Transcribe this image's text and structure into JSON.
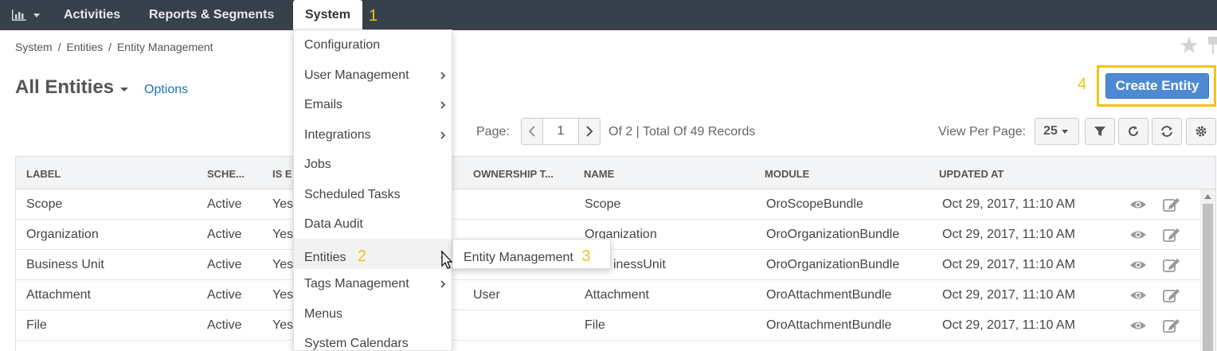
{
  "nav": {
    "items": [
      "Activities",
      "Reports & Segments",
      "System"
    ],
    "system_step": "1"
  },
  "breadcrumb": [
    "System",
    "/",
    "Entities",
    "/",
    "Entity Management"
  ],
  "heading": {
    "title": "All Entities",
    "options": "Options"
  },
  "create": {
    "label": "Create Entity",
    "step": "4"
  },
  "pager": {
    "label": "Page:",
    "page": "1",
    "info": "Of 2 | Total Of 49 Records",
    "view_per_page_label": "View Per Page:",
    "view_per_page": "25"
  },
  "table": {
    "headers": [
      "LABEL",
      "SCHE...",
      "IS E",
      "OWNERSHIP T...",
      "NAME",
      "MODULE",
      "UPDATED AT"
    ],
    "rows": [
      {
        "label": "Scope",
        "schema": "Active",
        "is": "Yes",
        "ownership": "",
        "name": "Scope",
        "module": "OroScopeBundle",
        "updated": "Oct 29, 2017, 11:10 AM"
      },
      {
        "label": "Organization",
        "schema": "Active",
        "is": "Yes",
        "ownership": "",
        "name": "Organization",
        "module": "OroOrganizationBundle",
        "updated": "Oct 29, 2017, 11:10 AM"
      },
      {
        "label": "Business Unit",
        "schema": "Active",
        "is": "Yes",
        "ownership": "",
        "name": "inessUnit",
        "module": "OroOrganizationBundle",
        "updated": "Oct 29, 2017, 11:10 AM"
      },
      {
        "label": "Attachment",
        "schema": "Active",
        "is": "Yes",
        "ownership": "User",
        "name": "Attachment",
        "module": "OroAttachmentBundle",
        "updated": "Oct 29, 2017, 11:10 AM"
      },
      {
        "label": "File",
        "schema": "Active",
        "is": "Yes",
        "ownership": "",
        "name": "File",
        "module": "OroAttachmentBundle",
        "updated": "Oct 29, 2017, 11:10 AM"
      }
    ]
  },
  "dropdown": {
    "items": [
      {
        "label": "Configuration",
        "submenu": false
      },
      {
        "label": "User Management",
        "submenu": true
      },
      {
        "label": "Emails",
        "submenu": true
      },
      {
        "label": "Integrations",
        "submenu": true
      },
      {
        "label": "Jobs",
        "submenu": false
      },
      {
        "label": "Scheduled Tasks",
        "submenu": false
      },
      {
        "label": "Data Audit",
        "submenu": false
      },
      {
        "label": "Entities",
        "submenu": true
      },
      {
        "label": "Tags Management",
        "submenu": true
      },
      {
        "label": "Menus",
        "submenu": false
      },
      {
        "label": "System Calendars",
        "submenu": false
      }
    ],
    "entities_step": "2",
    "submenu_label": "Entity Management",
    "submenu_step": "3"
  },
  "colors": {
    "nav_bg": "#37414c",
    "accent": "#4d8ad3",
    "highlight": "#f3c316",
    "link": "#1f72b5"
  },
  "icons": [
    "chart-icon",
    "caret-down-icon",
    "star-icon",
    "pin-icon",
    "chevron-left-icon",
    "chevron-right-icon",
    "filter-icon",
    "refresh-icon",
    "reset-icon",
    "gear-icon",
    "eye-icon",
    "edit-icon",
    "mouse-cursor-icon"
  ]
}
